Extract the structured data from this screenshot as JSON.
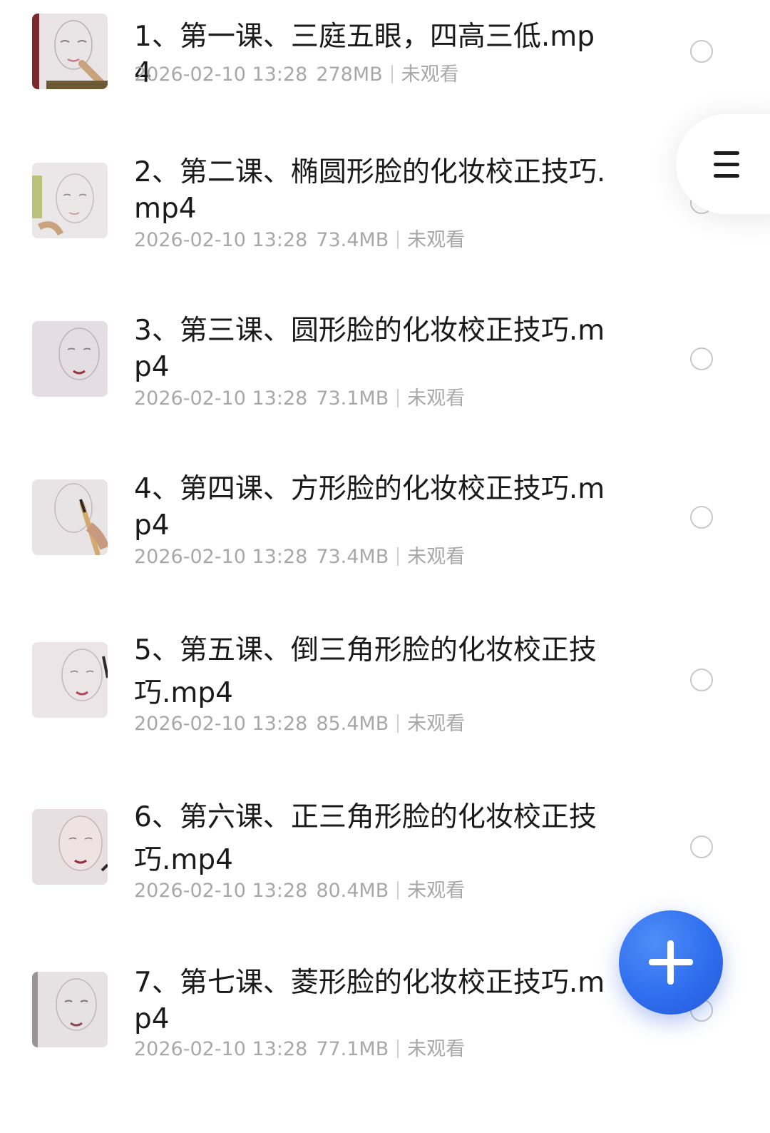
{
  "files": [
    {
      "title": "1、第一课、三庭五眼，四高三低.mp4",
      "datetime": "2026-02-10 13:28",
      "size": "278MB",
      "status": "未观看"
    },
    {
      "title": "2、第二课、椭圆形脸的化妆校正技巧.mp4",
      "datetime": "2026-02-10 13:28",
      "size": "73.4MB",
      "status": "未观看"
    },
    {
      "title": "3、第三课、圆形脸的化妆校正技巧.mp4",
      "datetime": "2026-02-10 13:28",
      "size": "73.1MB",
      "status": "未观看"
    },
    {
      "title": "4、第四课、方形脸的化妆校正技巧.mp4",
      "datetime": "2026-02-10 13:28",
      "size": "73.4MB",
      "status": "未观看"
    },
    {
      "title": "5、第五课、倒三角形脸的化妆校正技巧.mp4",
      "datetime": "2026-02-10 13:28",
      "size": "85.4MB",
      "status": "未观看"
    },
    {
      "title": "6、第六课、正三角形脸的化妆校正技巧.mp4",
      "datetime": "2026-02-10 13:28",
      "size": "80.4MB",
      "status": "未观看"
    },
    {
      "title": "7、第七课、菱形脸的化妆校正技巧.mp4",
      "datetime": "2026-02-10 13:28",
      "size": "77.1MB",
      "status": "未观看"
    }
  ],
  "icons": {
    "menu": "hamburger-icon",
    "add": "plus-icon",
    "select": "radio-circle-icon"
  },
  "colors": {
    "fab": "#2f6eee",
    "title_text": "#1a1a1a",
    "meta_text": "#a8a8a8"
  }
}
